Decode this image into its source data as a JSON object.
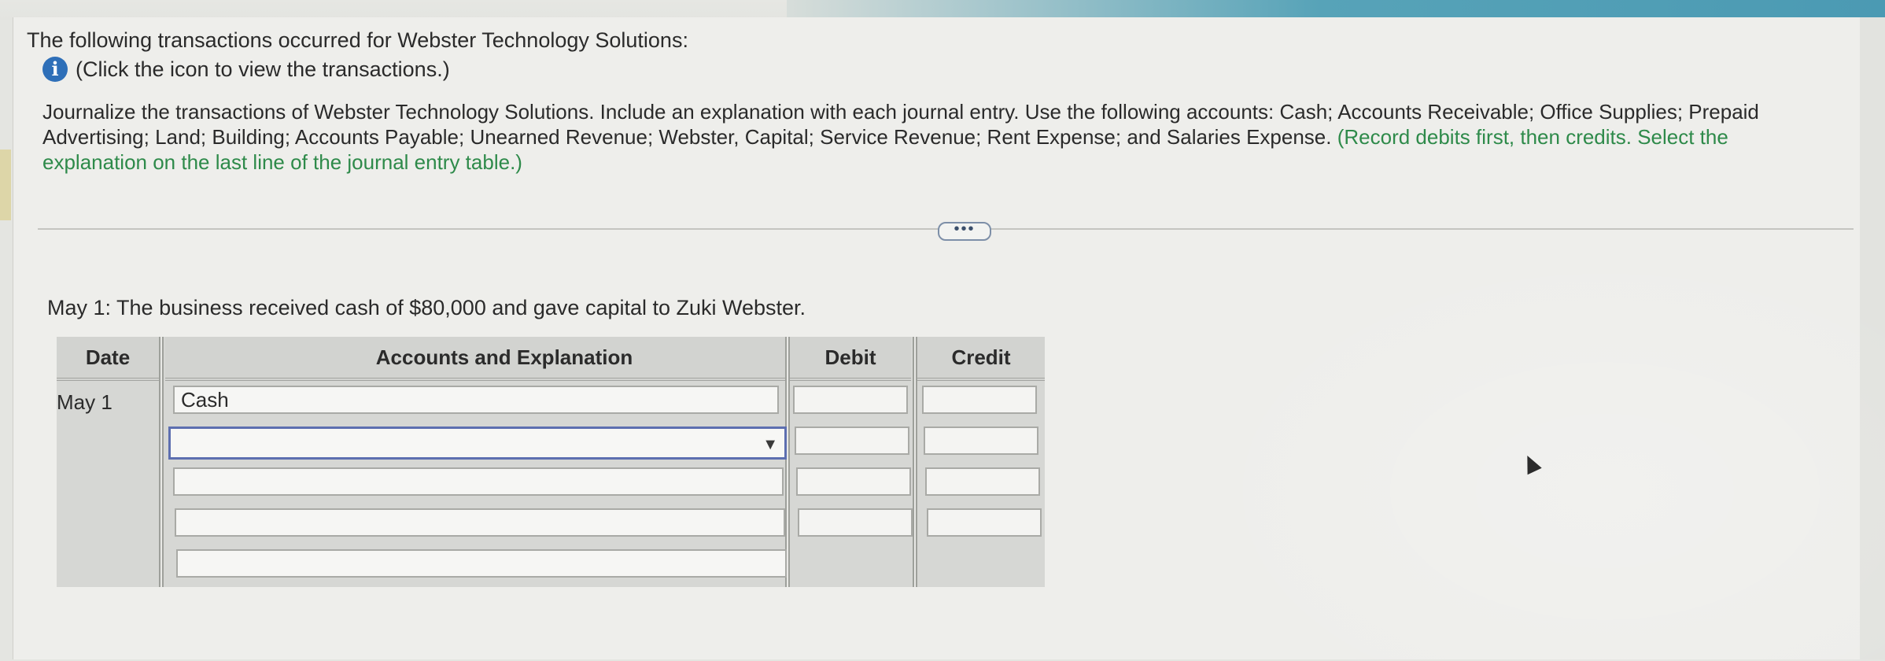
{
  "question": {
    "title": "The following transactions occurred for Webster Technology Solutions:",
    "info_link": "(Click the icon to view the transactions.)",
    "info_icon": "info-icon",
    "instructions_main": "Journalize the transactions of Webster Technology Solutions. Include an explanation with each journal entry. Use the following accounts: Cash; Accounts Receivable; Office Supplies; Prepaid Advertising; Land; Building; Accounts Payable; Unearned Revenue; Webster, Capital; Service Revenue; Rent Expense; and Salaries Expense.",
    "instructions_note": "(Record debits first, then credits. Select the explanation on the last line of the journal entry table.)"
  },
  "more_button": "•••",
  "prompt": "May 1: The business received cash of $80,000 and gave capital to Zuki Webster.",
  "journal": {
    "headers": {
      "date": "Date",
      "accounts": "Accounts and Explanation",
      "debit": "Debit",
      "credit": "Credit"
    },
    "date": "May 1",
    "rows": [
      {
        "account": "Cash",
        "debit": "",
        "credit": ""
      },
      {
        "account": "",
        "debit": "",
        "credit": ""
      },
      {
        "account": "",
        "debit": "",
        "credit": ""
      },
      {
        "account": "",
        "debit": "",
        "credit": ""
      },
      {
        "account": ""
      }
    ],
    "dropdown_arrow": "▼"
  }
}
